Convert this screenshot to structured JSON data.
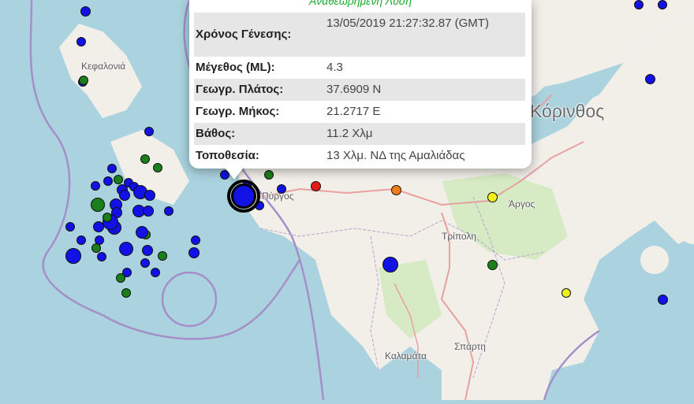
{
  "popup": {
    "title": "Αναθεωρημένη Λύση",
    "rows": [
      {
        "label": "Χρόνος Γένεσης:",
        "value": "13/05/2019 21:27:32.87 (GMT)"
      },
      {
        "label": "Μέγεθος (ML):",
        "value": "4.3"
      },
      {
        "label": "Γεωγρ. Πλάτος:",
        "value": "37.6909 N"
      },
      {
        "label": "Γεωγρ. Μήκος:",
        "value": "21.2717 E"
      },
      {
        "label": "Βάθος:",
        "value": "11.2 Χλμ"
      },
      {
        "label": "Τοποθεσία:",
        "value": "13 Χλμ. ΝΔ της Αμαλιάδας"
      }
    ]
  },
  "places": {
    "kefalonia": "Κεφαλονιά",
    "korinthos": "Κόρινθος",
    "pyrgos": "Πύργος",
    "argos": "Άργος",
    "tripoli": "Τρίπολη",
    "sparti": "Σπάρτη",
    "kalamata": "Καλαμάτα"
  },
  "colors": {
    "sea": "#aad3df",
    "land": "#f2efe9",
    "green_land": "#c8e6b0",
    "boundary": "#a58fc9",
    "road": "#e8a0a0",
    "marker_blue": "#1212e6",
    "marker_green": "#1a7f1a",
    "marker_red": "#e61919",
    "marker_orange": "#f07c1c",
    "marker_yellow": "#f0f01e",
    "popup_title": "#1cab2e"
  },
  "markers": [
    {
      "color": "blue",
      "size": 13
    },
    {
      "color": "blue",
      "size": 12
    },
    {
      "color": "blue",
      "size": 12
    },
    {
      "color": "green",
      "size": 12
    },
    {
      "color": "blue",
      "size": 12
    },
    {
      "color": "blue",
      "size": 12
    },
    {
      "color": "blue",
      "size": 12
    },
    {
      "color": "green",
      "size": 12
    },
    {
      "color": "blue",
      "size": 12
    },
    {
      "color": "green",
      "size": 12
    },
    {
      "color": "blue",
      "size": 12
    },
    {
      "color": "green",
      "size": 12
    },
    {
      "color": "blue",
      "size": 14
    },
    {
      "color": "blue",
      "size": 12
    },
    {
      "color": "blue",
      "size": 14
    },
    {
      "color": "green",
      "size": 18
    },
    {
      "color": "blue",
      "size": 16
    },
    {
      "color": "blue",
      "size": 18
    },
    {
      "color": "blue",
      "size": 14
    },
    {
      "color": "blue",
      "size": 16
    },
    {
      "color": "blue",
      "size": 14
    },
    {
      "color": "blue",
      "size": 18
    },
    {
      "color": "blue",
      "size": 14
    },
    {
      "color": "blue",
      "size": 20
    },
    {
      "color": "green",
      "size": 12
    },
    {
      "color": "blue",
      "size": 12
    },
    {
      "color": "blue",
      "size": 14
    },
    {
      "color": "blue",
      "size": 12
    },
    {
      "color": "green",
      "size": 12
    },
    {
      "color": "blue",
      "size": 12
    },
    {
      "color": "blue",
      "size": 16
    },
    {
      "color": "blue",
      "size": 14
    },
    {
      "color": "blue",
      "size": 18
    },
    {
      "color": "blue",
      "size": 12
    },
    {
      "color": "blue",
      "size": 14
    },
    {
      "color": "green",
      "size": 12
    },
    {
      "color": "blue",
      "size": 12
    },
    {
      "color": "blue",
      "size": 20
    },
    {
      "color": "green",
      "size": 12
    },
    {
      "color": "blue",
      "size": 12
    },
    {
      "color": "blue",
      "size": 12
    },
    {
      "color": "green",
      "size": 12
    },
    {
      "color": "blue",
      "size": 12
    },
    {
      "color": "blue",
      "size": 12
    },
    {
      "color": "blue",
      "size": 12
    },
    {
      "color": "green",
      "size": 12
    },
    {
      "color": "red",
      "size": 13
    },
    {
      "color": "orange",
      "size": 13
    },
    {
      "color": "yellow",
      "size": 13
    },
    {
      "color": "blue",
      "size": 12
    },
    {
      "color": "blue",
      "size": 20
    },
    {
      "color": "green",
      "size": 13
    },
    {
      "color": "yellow",
      "size": 12
    },
    {
      "color": "blue",
      "size": 13
    },
    {
      "color": "blue",
      "size": 13
    },
    {
      "color": "blue",
      "size": 12
    },
    {
      "color": "blue",
      "size": 12
    },
    {
      "color": "blue",
      "size": 12
    },
    {
      "color": "green",
      "size": 12
    },
    {
      "color": "blue",
      "size": 12
    },
    {
      "color": "blue",
      "size": 12
    }
  ],
  "selected_marker": {
    "color": "blue",
    "size": 32
  }
}
